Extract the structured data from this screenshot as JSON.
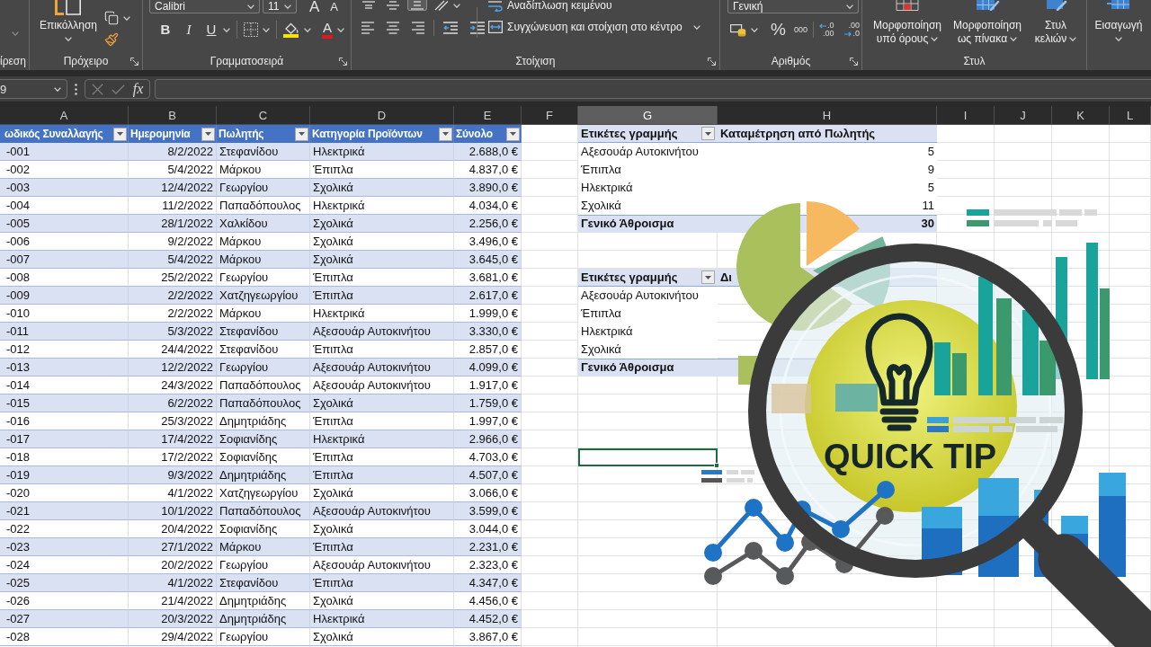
{
  "ribbon": {
    "undo": {
      "label": "ίρεση"
    },
    "clipboard": {
      "label": "Πρόχειρο",
      "paste": "Επικόλληση"
    },
    "font": {
      "label": "Γραμματοσειρά",
      "font_name": "Calibri",
      "font_size": "11",
      "grow": "A",
      "shrink": "A",
      "bold": "B",
      "italic": "I",
      "underline": "U",
      "font_color": "A"
    },
    "alignment": {
      "label": "Στοίχιση",
      "vertical_align": [
        {
          "kind": "top",
          "selected": false
        },
        {
          "kind": "middle",
          "selected": false
        },
        {
          "kind": "bottom",
          "selected": true
        }
      ],
      "wrap_text": "Αναδίπλωση κειμένου",
      "merge": "Συγχώνευση και στοίχιση στο κέντρο"
    },
    "number": {
      "label": "Αριθμός",
      "format": "Γενική",
      "percent": "%",
      "thousands": "000",
      "decimals": [
        {
          "kind": "increase",
          "top": ".0",
          "bottom": ".00"
        },
        {
          "kind": "decrease",
          "top": ".00",
          "bottom": ".0"
        }
      ]
    },
    "styles": {
      "label": "Στυλ",
      "buttons": [
        {
          "kind": "conditional",
          "lines": [
            "Μορφοποίηση",
            "υπό όρους"
          ]
        },
        {
          "kind": "table",
          "lines": [
            "Μορφοποίηση",
            "ως πίνακα"
          ]
        },
        {
          "kind": "cell_style",
          "lines": [
            "Στυλ",
            "κελιών"
          ]
        }
      ]
    },
    "cells": {
      "insert": "Εισαγωγή"
    }
  },
  "formula_bar": {
    "name_box": "9",
    "function_button": "fx"
  },
  "column_headers": [
    {
      "label": "A",
      "selected": false
    },
    {
      "label": "B",
      "selected": false
    },
    {
      "label": "C",
      "selected": false
    },
    {
      "label": "D",
      "selected": false
    },
    {
      "label": "E",
      "selected": false
    },
    {
      "label": "F",
      "selected": false
    },
    {
      "label": "G",
      "selected": true
    },
    {
      "label": "H",
      "selected": false
    },
    {
      "label": "I",
      "selected": false
    },
    {
      "label": "J",
      "selected": false
    },
    {
      "label": "K",
      "selected": false
    },
    {
      "label": "L",
      "selected": false
    }
  ],
  "sheet_rows": [
    {
      "selected": false
    },
    {
      "selected": false
    },
    {
      "selected": false
    },
    {
      "selected": false
    },
    {
      "selected": false
    },
    {
      "selected": false
    },
    {
      "selected": false
    },
    {
      "selected": false
    },
    {
      "selected": false
    },
    {
      "selected": false
    },
    {
      "selected": false
    },
    {
      "selected": false
    },
    {
      "selected": false
    },
    {
      "selected": false
    },
    {
      "selected": false
    },
    {
      "selected": false
    },
    {
      "selected": false
    },
    {
      "selected": false
    },
    {
      "selected": true
    },
    {
      "selected": false
    },
    {
      "selected": false
    },
    {
      "selected": false
    },
    {
      "selected": false
    },
    {
      "selected": false
    },
    {
      "selected": false
    },
    {
      "selected": false
    },
    {
      "selected": false
    },
    {
      "selected": false
    },
    {
      "selected": false
    }
  ],
  "table": {
    "columns": [
      "ωδικός Συναλλαγής",
      "Ημερομηνία",
      "Πωλητής",
      "Κατηγορία Προϊόντων",
      "Σύνολο"
    ],
    "rows": [
      [
        "-001",
        "8/2/2022",
        "Στεφανίδου",
        "Ηλεκτρικά",
        "2.688,0 €"
      ],
      [
        "-002",
        "5/4/2022",
        "Μάρκου",
        "Έπιπλα",
        "4.837,0 €"
      ],
      [
        "-003",
        "12/4/2022",
        "Γεωργίου",
        "Σχολικά",
        "3.890,0 €"
      ],
      [
        "-004",
        "11/2/2022",
        "Παπαδόπουλος",
        "Ηλεκτρικά",
        "4.034,0 €"
      ],
      [
        "-005",
        "28/1/2022",
        "Χαλκίδου",
        "Σχολικά",
        "2.256,0 €"
      ],
      [
        "-006",
        "9/2/2022",
        "Μάρκου",
        "Σχολικά",
        "3.496,0 €"
      ],
      [
        "-007",
        "5/4/2022",
        "Μάρκου",
        "Σχολικά",
        "3.645,0 €"
      ],
      [
        "-008",
        "25/2/2022",
        "Γεωργίου",
        "Έπιπλα",
        "3.681,0 €"
      ],
      [
        "-009",
        "2/2/2022",
        "Χατζηγεωργίου",
        "Έπιπλα",
        "2.617,0 €"
      ],
      [
        "-010",
        "2/2/2022",
        "Μάρκου",
        "Ηλεκτρικά",
        "1.999,0 €"
      ],
      [
        "-011",
        "5/3/2022",
        "Στεφανίδου",
        "Αξεσουάρ Αυτοκινήτου",
        "3.330,0 €"
      ],
      [
        "-012",
        "24/4/2022",
        "Στεφανίδου",
        "Έπιπλα",
        "2.857,0 €"
      ],
      [
        "-013",
        "12/2/2022",
        "Γεωργίου",
        "Αξεσουάρ Αυτοκινήτου",
        "4.099,0 €"
      ],
      [
        "-014",
        "24/3/2022",
        "Παπαδόπουλος",
        "Αξεσουάρ Αυτοκινήτου",
        "1.917,0 €"
      ],
      [
        "-015",
        "6/2/2022",
        "Παπαδόπουλος",
        "Σχολικά",
        "1.759,0 €"
      ],
      [
        "-016",
        "25/3/2022",
        "Δημητριάδης",
        "Έπιπλα",
        "1.997,0 €"
      ],
      [
        "-017",
        "17/4/2022",
        "Σοφιανίδης",
        "Ηλεκτρικά",
        "2.966,0 €"
      ],
      [
        "-018",
        "17/2/2022",
        "Σοφιανίδης",
        "Έπιπλα",
        "4.703,0 €"
      ],
      [
        "-019",
        "9/3/2022",
        "Δημητριάδης",
        "Έπιπλα",
        "4.507,0 €"
      ],
      [
        "-020",
        "4/1/2022",
        "Χατζηγεωργίου",
        "Σχολικά",
        "3.066,0 €"
      ],
      [
        "-021",
        "10/1/2022",
        "Παπαδόπουλος",
        "Αξεσουάρ Αυτοκινήτου",
        "3.599,0 €"
      ],
      [
        "-022",
        "20/4/2022",
        "Σοφιανίδης",
        "Σχολικά",
        "3.044,0 €"
      ],
      [
        "-023",
        "27/1/2022",
        "Μάρκου",
        "Έπιπλα",
        "2.231,0 €"
      ],
      [
        "-024",
        "20/2/2022",
        "Γεωργίου",
        "Αξεσουάρ Αυτοκινήτου",
        "2.323,0 €"
      ],
      [
        "-025",
        "4/1/2022",
        "Στεφανίδου",
        "Έπιπλα",
        "4.347,0 €"
      ],
      [
        "-026",
        "21/4/2022",
        "Δημητριάδης",
        "Σχολικά",
        "4.456,0 €"
      ],
      [
        "-027",
        "20/3/2022",
        "Δημητριάδης",
        "Ηλεκτρικά",
        "4.452,0 €"
      ],
      [
        "-028",
        "29/4/2022",
        "Γεωργίου",
        "Σχολικά",
        "3.867,0 €"
      ]
    ]
  },
  "pivot_tables": [
    {
      "header": [
        "Ετικέτες γραμμής",
        "Καταμέτρηση από Πωλητής"
      ],
      "rows": [
        [
          "Αξεσουάρ Αυτοκινήτου",
          "5"
        ],
        [
          "Έπιπλα",
          "9"
        ],
        [
          "Ηλεκτρικά",
          "5"
        ],
        [
          "Σχολικά",
          "11"
        ]
      ],
      "total": [
        "Γενικό Άθροισμα",
        "30"
      ]
    },
    {
      "header": [
        "Ετικέτες γραμμής",
        "Δι"
      ],
      "rows": [
        [
          "Αξεσουάρ Αυτοκινήτου"
        ],
        [
          "Έπιπλα"
        ],
        [
          "Ηλεκτρικά"
        ],
        [
          "Σχολικά"
        ]
      ],
      "total": [
        "Γενικό Άθροισμα"
      ]
    }
  ],
  "overlay": {
    "caption": "QUICK TIP"
  }
}
